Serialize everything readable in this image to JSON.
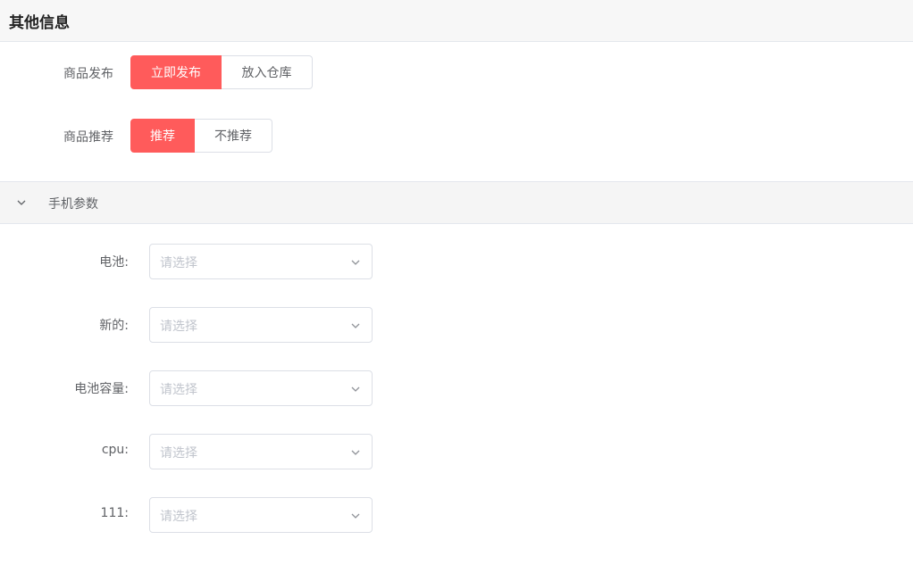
{
  "section": {
    "title": "其他信息"
  },
  "publish": {
    "label": "商品发布",
    "options": [
      "立即发布",
      "放入仓库"
    ],
    "selected": "立即发布"
  },
  "recommend": {
    "label": "商品推荐",
    "options": [
      "推荐",
      "不推荐"
    ],
    "selected": "推荐"
  },
  "phone_params": {
    "title": "手机参数",
    "expanded": true,
    "icon": "chevron-down-icon",
    "fields": [
      {
        "label": "电池:",
        "placeholder": "请选择"
      },
      {
        "label": "新的:",
        "placeholder": "请选择"
      },
      {
        "label": "电池容量:",
        "placeholder": "请选择"
      },
      {
        "label": "cpu:",
        "placeholder": "请选择"
      },
      {
        "label": "111:",
        "placeholder": "请选择"
      }
    ]
  },
  "colors": {
    "accent": "#ff5b5b",
    "border": "#dcdfe6",
    "placeholder": "#c0c4cc"
  }
}
